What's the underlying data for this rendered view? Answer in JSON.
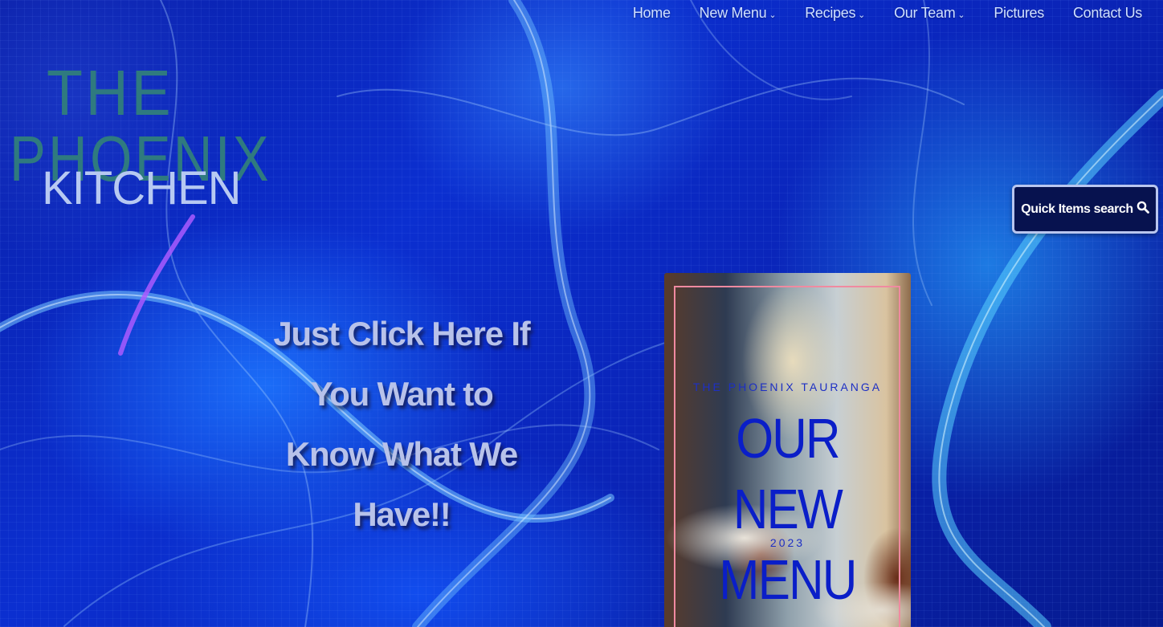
{
  "nav": {
    "items": [
      {
        "label": "Home",
        "has_dropdown": false
      },
      {
        "label": "New Menu",
        "has_dropdown": true
      },
      {
        "label": "Recipes",
        "has_dropdown": true
      },
      {
        "label": "Our Team",
        "has_dropdown": true
      },
      {
        "label": "Pictures",
        "has_dropdown": false
      },
      {
        "label": "Contact Us",
        "has_dropdown": false
      }
    ],
    "dropdown_icon": "chevron-down-icon"
  },
  "logo": {
    "line1": "THE",
    "line2": "PHOENIX",
    "line3": "KITCHEN",
    "color_primary": "#2f7a7f",
    "color_secondary": "#b7c9f2"
  },
  "search_button": {
    "label": "Quick Items search",
    "icon": "search-icon"
  },
  "cta": {
    "text": "Just Click Here If You Want to Know What We Have!!"
  },
  "menu_card": {
    "subtitle": "THE PHOENIX TAURANGA",
    "title": "OUR NEW MENU",
    "year": "2023",
    "title_color": "#0a1ec8",
    "frame_color": "#f08aa0"
  },
  "colors": {
    "background": "#0b2fd0",
    "nav_text": "#cfe0ff",
    "button_bg": "#07124f"
  }
}
